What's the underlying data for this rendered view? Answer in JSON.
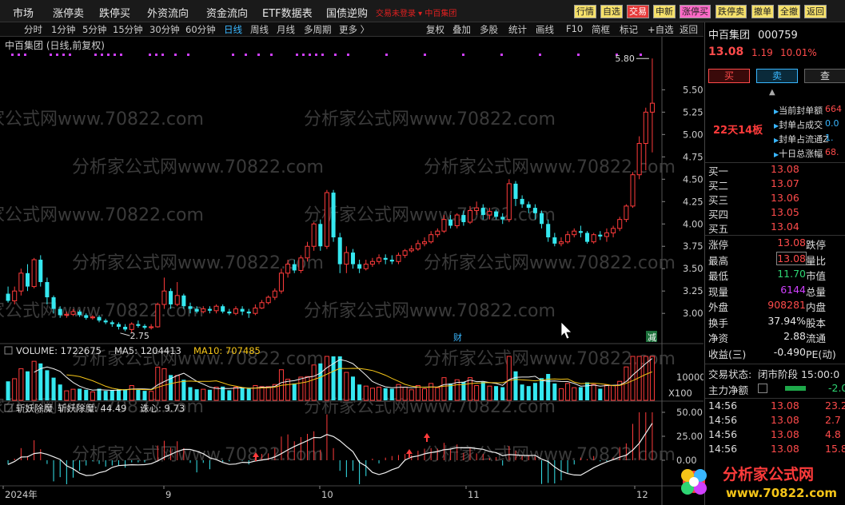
{
  "menu": {
    "items": [
      "市场",
      "涨停卖",
      "跌停买",
      "外资流向",
      "资金流向",
      "ETF数据表",
      "国债逆购"
    ],
    "status_text": "交易未登录 ▾  中百集团",
    "quick_buttons": [
      {
        "label": "行情",
        "bg": "#f5e06a",
        "fg": "#222"
      },
      {
        "label": "自选",
        "bg": "#f5e06a",
        "fg": "#222"
      },
      {
        "label": "交易",
        "bg": "#e63b3b",
        "fg": "#fff"
      },
      {
        "label": "申新",
        "bg": "#f5e06a",
        "fg": "#222"
      },
      {
        "label": "涨停买",
        "bg": "#ff69c8",
        "fg": "#222"
      },
      {
        "label": "跌停卖",
        "bg": "#f5e06a",
        "fg": "#222"
      },
      {
        "label": "撤单",
        "bg": "#f5e06a",
        "fg": "#222"
      },
      {
        "label": "全撤",
        "bg": "#f5e06a",
        "fg": "#222"
      },
      {
        "label": "返回",
        "bg": "#f5e06a",
        "fg": "#222"
      }
    ]
  },
  "toolbar": {
    "periods": [
      "分时",
      "1分钟",
      "5分钟",
      "15分钟",
      "30分钟",
      "60分钟",
      "日线",
      "周线",
      "月线",
      "多周期",
      "更多 〉"
    ],
    "active": "日线",
    "tools": [
      "复权",
      "叠加",
      "多股",
      "统计",
      "画线",
      "F10",
      "简框",
      "标记",
      "+自选",
      "返回"
    ]
  },
  "chart": {
    "title": "中百集团 (日线,前复权)",
    "high_label": "5.80",
    "low_label": "2.75",
    "fin_marker": "财",
    "reduce_marker": "减",
    "volume_header": {
      "volume": "VOLUME: 1722675",
      "ma5": "MA5: 1204413",
      "ma10": "MA10: 707485"
    },
    "volume_scale": [
      "10000",
      "X100"
    ],
    "indicator_header": {
      "name": "斩妖除魔",
      "value": "斩妖除魔: 44.49",
      "heart": "诛心: 9.73"
    },
    "indicator_scale": [
      "50.00",
      "25.00",
      "0.00"
    ],
    "x_labels": [
      "2024年",
      "9",
      "10",
      "11",
      "12"
    ],
    "watermark": "分析家公式网www.70822.com",
    "colors": {
      "up": "#ff3b3b",
      "down": "#35e8f0",
      "ma5": "#f0f0f0",
      "ma10": "#f5c518",
      "purple_dots": "#d040ff"
    }
  },
  "chart_data": {
    "type": "candlestick",
    "y_axis": {
      "ticks": [
        3.0,
        3.25,
        3.5,
        3.75,
        4.0,
        4.25,
        4.5,
        4.75,
        5.0,
        5.25,
        5.5
      ],
      "ylim": [
        2.68,
        5.95
      ]
    },
    "x_axis_labels": [
      "2024年",
      "9",
      "10",
      "11",
      "12"
    ],
    "candles_approx": [
      [
        3.22,
        3.14,
        3.3,
        3.12
      ],
      [
        3.14,
        3.25,
        3.3,
        3.1
      ],
      [
        3.25,
        3.45,
        3.5,
        3.2
      ],
      [
        3.45,
        3.3,
        3.55,
        3.25
      ],
      [
        3.3,
        3.6,
        3.62,
        3.28
      ],
      [
        3.6,
        3.35,
        3.65,
        3.3
      ],
      [
        3.35,
        3.18,
        3.4,
        3.1
      ],
      [
        3.18,
        3.05,
        3.2,
        3.0
      ],
      [
        3.05,
        2.98,
        3.08,
        2.95
      ],
      [
        2.98,
        2.99,
        3.02,
        2.95
      ],
      [
        2.99,
        3.02,
        3.05,
        2.97
      ],
      [
        3.02,
        2.98,
        3.04,
        2.96
      ],
      [
        2.98,
        2.95,
        3.0,
        2.93
      ],
      [
        2.95,
        2.96,
        2.98,
        2.93
      ],
      [
        2.96,
        2.92,
        2.98,
        2.9
      ],
      [
        2.92,
        2.9,
        2.94,
        2.88
      ],
      [
        2.9,
        2.88,
        2.92,
        2.85
      ],
      [
        2.88,
        2.85,
        2.9,
        2.82
      ],
      [
        2.85,
        2.82,
        2.88,
        2.8
      ],
      [
        2.82,
        2.88,
        2.9,
        2.78
      ],
      [
        2.88,
        2.86,
        2.92,
        2.84
      ],
      [
        2.86,
        2.84,
        2.88,
        2.82
      ],
      [
        2.84,
        2.85,
        2.88,
        2.82
      ],
      [
        2.85,
        3.1,
        3.12,
        2.84
      ],
      [
        3.1,
        3.25,
        3.4,
        3.05
      ],
      [
        3.25,
        3.1,
        3.28,
        3.05
      ],
      [
        3.1,
        3.2,
        3.35,
        3.08
      ],
      [
        3.2,
        3.08,
        3.22,
        3.05
      ],
      [
        3.08,
        3.05,
        3.12,
        3.0
      ],
      [
        3.05,
        3.02,
        3.08,
        3.0
      ],
      [
        3.02,
        3.05,
        3.08,
        3.0
      ],
      [
        3.05,
        3.03,
        3.08,
        3.0
      ],
      [
        3.03,
        3.08,
        3.1,
        3.0
      ],
      [
        3.08,
        3.02,
        3.1,
        3.0
      ],
      [
        3.02,
        3.0,
        3.05,
        2.98
      ],
      [
        3.0,
        3.05,
        3.08,
        2.98
      ],
      [
        3.05,
        3.02,
        3.08,
        2.98
      ],
      [
        3.02,
        3.0,
        3.05,
        2.95
      ],
      [
        3.0,
        3.06,
        3.1,
        2.98
      ],
      [
        3.06,
        3.12,
        3.15,
        3.05
      ],
      [
        3.12,
        3.18,
        3.2,
        3.1
      ],
      [
        3.18,
        3.25,
        3.28,
        3.15
      ],
      [
        3.25,
        3.45,
        3.5,
        3.22
      ],
      [
        3.45,
        3.55,
        3.6,
        3.4
      ],
      [
        3.55,
        3.48,
        3.6,
        3.45
      ],
      [
        3.48,
        3.62,
        3.65,
        3.45
      ],
      [
        3.62,
        3.75,
        3.8,
        3.58
      ],
      [
        3.75,
        4.0,
        4.02,
        3.7
      ],
      [
        4.0,
        3.75,
        4.05,
        3.7
      ],
      [
        3.75,
        4.35,
        4.38,
        3.72
      ],
      [
        4.35,
        3.85,
        4.38,
        3.8
      ],
      [
        3.85,
        3.55,
        3.9,
        3.45
      ],
      [
        3.55,
        3.68,
        3.75,
        3.45
      ],
      [
        3.68,
        3.55,
        3.72,
        3.5
      ],
      [
        3.55,
        3.5,
        3.6,
        3.45
      ],
      [
        3.5,
        3.55,
        3.6,
        3.48
      ],
      [
        3.55,
        3.58,
        3.62,
        3.52
      ],
      [
        3.58,
        3.62,
        3.66,
        3.55
      ],
      [
        3.62,
        3.6,
        3.66,
        3.55
      ],
      [
        3.6,
        3.58,
        3.65,
        3.55
      ],
      [
        3.58,
        3.65,
        3.68,
        3.55
      ],
      [
        3.65,
        3.7,
        3.72,
        3.62
      ],
      [
        3.7,
        3.72,
        3.76,
        3.68
      ],
      [
        3.72,
        3.78,
        3.82,
        3.7
      ],
      [
        3.78,
        3.8,
        3.85,
        3.75
      ],
      [
        3.8,
        3.88,
        3.92,
        3.78
      ],
      [
        3.88,
        3.92,
        3.95,
        3.85
      ],
      [
        3.92,
        4.05,
        4.1,
        3.9
      ],
      [
        4.05,
        3.98,
        4.1,
        3.95
      ],
      [
        3.98,
        4.1,
        4.12,
        3.95
      ],
      [
        4.1,
        4.02,
        4.15,
        3.98
      ],
      [
        4.02,
        4.15,
        4.2,
        4.0
      ],
      [
        4.15,
        4.18,
        4.25,
        4.1
      ],
      [
        4.18,
        4.1,
        4.22,
        4.05
      ],
      [
        4.1,
        4.14,
        4.18,
        4.05
      ],
      [
        4.14,
        4.08,
        4.16,
        4.05
      ],
      [
        4.08,
        4.05,
        4.12,
        4.0
      ],
      [
        4.05,
        4.45,
        4.5,
        4.02
      ],
      [
        4.45,
        4.28,
        4.48,
        4.2
      ],
      [
        4.28,
        4.22,
        4.32,
        4.18
      ],
      [
        4.22,
        4.18,
        4.25,
        4.12
      ],
      [
        4.18,
        4.12,
        4.22,
        4.05
      ],
      [
        4.12,
        4.0,
        4.15,
        3.95
      ],
      [
        4.0,
        3.85,
        4.05,
        3.8
      ],
      [
        3.85,
        3.78,
        3.9,
        3.75
      ],
      [
        3.78,
        3.8,
        3.85,
        3.75
      ],
      [
        3.8,
        3.88,
        3.92,
        3.78
      ],
      [
        3.88,
        3.92,
        3.95,
        3.85
      ],
      [
        3.92,
        3.9,
        3.98,
        3.85
      ],
      [
        3.9,
        3.8,
        3.92,
        3.78
      ],
      [
        3.8,
        3.88,
        3.9,
        3.78
      ],
      [
        3.88,
        3.86,
        3.92,
        3.82
      ],
      [
        3.86,
        3.9,
        3.95,
        3.8
      ],
      [
        3.9,
        3.95,
        3.98,
        3.85
      ],
      [
        3.95,
        4.05,
        4.08,
        3.92
      ],
      [
        4.05,
        4.2,
        4.22,
        4.02
      ],
      [
        4.2,
        4.55,
        4.58,
        4.18
      ],
      [
        4.55,
        4.9,
        4.98,
        4.5
      ],
      [
        4.9,
        5.25,
        5.3,
        4.6
      ],
      [
        5.25,
        5.35,
        5.85,
        4.8
      ]
    ],
    "volume_series": {
      "name": "VOLUME",
      "last": 1722675,
      "ma5_last": 1204413,
      "ma10_last": 707485
    },
    "indicator_series": {
      "name": "斩妖除魔",
      "last": 44.49,
      "heart_last": 9.73,
      "ylim": [
        -25,
        50
      ]
    }
  },
  "panel": {
    "name": "中百集团",
    "code": "000759",
    "price": "13.08",
    "change": "1.19",
    "change_pct": "10.01%",
    "buttons": [
      "买",
      "卖",
      "查"
    ],
    "badge": "22天14板",
    "seal": [
      {
        "label": "当前封单额",
        "value": "664",
        "color": "#ff4b4b"
      },
      {
        "label": "封单占成交",
        "value": "0.0",
        "color": "#39b7ff"
      },
      {
        "label": "封单占流通Z",
        "value": "1.",
        "color": "#39b7ff"
      },
      {
        "label": "十日总涨幅",
        "value": "68.",
        "color": "#ff4b4b"
      }
    ],
    "orderbook": [
      {
        "label": "买一",
        "price": "13.08"
      },
      {
        "label": "买二",
        "price": "13.07"
      },
      {
        "label": "买三",
        "price": "13.06"
      },
      {
        "label": "买四",
        "price": "13.05"
      },
      {
        "label": "买五",
        "price": "13.04"
      }
    ],
    "stats": [
      {
        "k1": "涨停",
        "v1": "13.08",
        "c1": "#ff4b4b",
        "k2": "跌停",
        "v2": ""
      },
      {
        "k1": "最高",
        "v1": "13.08",
        "c1": "#ff4b4b",
        "k2": "量比",
        "v2": ""
      },
      {
        "k1": "最低",
        "v1": "11.70",
        "c1": "#2ed573",
        "k2": "市值",
        "v2": ""
      },
      {
        "k1": "现量",
        "v1": "6144",
        "c1": "#d040ff",
        "k2": "总量",
        "v2": ""
      },
      {
        "k1": "外盘",
        "v1": "908281",
        "c1": "#ff4b4b",
        "k2": "内盘",
        "v2": ""
      },
      {
        "k1": "换手",
        "v1": "37.94%",
        "c1": "#e6e6e6",
        "k2": "股本",
        "v2": ""
      },
      {
        "k1": "净资",
        "v1": "2.88",
        "c1": "#e6e6e6",
        "k2": "流通",
        "v2": ""
      },
      {
        "k1": "收益(三)",
        "v1": "-0.490",
        "c1": "#e6e6e6",
        "k2": "PE(动)",
        "v2": ""
      }
    ],
    "trade_state_label": "交易状态:",
    "trade_state": "闭市阶段 15:00:0",
    "main_flow_label": "主力净额",
    "main_flow_value": "-2.0",
    "ticks": [
      {
        "time": "14:56",
        "price": "13.08",
        "vol": "23.2"
      },
      {
        "time": "14:56",
        "price": "13.08",
        "vol": "2.7"
      },
      {
        "time": "14:56",
        "price": "13.08",
        "vol": "4.8"
      },
      {
        "time": "14:56",
        "price": "13.08",
        "vol": "15.8"
      }
    ]
  },
  "logo": {
    "text": "分析家公式网",
    "url": "www.70822.com"
  }
}
